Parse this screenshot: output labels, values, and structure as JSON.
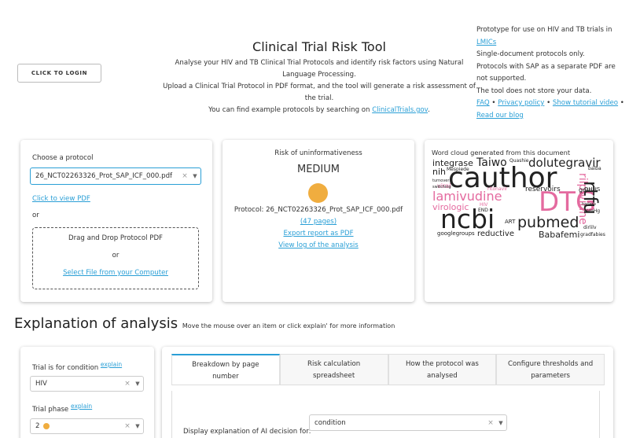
{
  "login": {
    "label": "CLICK TO LOGIN"
  },
  "header": {
    "title": "Clinical Trial Risk Tool",
    "line1": "Analyse your HIV and TB Clinical Trial Protocols and identify risk factors using Natural",
    "line2": "Language Processing.",
    "line3": "Upload a Clinical Trial Protocol in PDF format, and the tool will generate a risk assessment of",
    "line4": "the trial.",
    "line5_prefix": "You can find example protocols by searching on ",
    "line5_link": "ClinicalTrials.gov",
    "line5_suffix": "."
  },
  "info": {
    "line1": "Prototype for use on HIV and TB trials in",
    "lmics": "LMICs",
    "line2": "Single-document protocols only.",
    "line3": "Protocols with SAP as a separate PDF are",
    "line4": "not supported.",
    "line5": "The tool does not store your data.",
    "faq": "FAQ",
    "bullet": "•",
    "privacy": "Privacy policy",
    "tutorial": "Show tutorial video",
    "blog": "Read our blog"
  },
  "protocol_card": {
    "label": "Choose a protocol",
    "selected": "26_NCT02263326_Prot_SAP_ICF_000.pdf",
    "view_pdf": "Click to view PDF",
    "or": "or",
    "drop_text": "Drag and Drop Protocol PDF",
    "drop_or": "or",
    "select_file": "Select File from your Computer"
  },
  "risk_card": {
    "title": "Risk of uninformativeness",
    "level": "MEDIUM",
    "level_color": "#f0ad3f",
    "protocol": "Protocol: 26_NCT02263326_Prot_SAP_ICF_000.pdf",
    "pages": "(47 pages)",
    "export": "Export report as PDF",
    "log": "View log of the analysis"
  },
  "wordcloud": {
    "title": "Word cloud generated from this document",
    "words": [
      {
        "text": "integrase",
        "color": "#222222"
      },
      {
        "text": "Taiwo",
        "color": "#222222"
      },
      {
        "text": "Quashie",
        "color": "#222222"
      },
      {
        "text": "dolutegravir",
        "color": "#222222"
      },
      {
        "text": "nih",
        "color": "#222222"
      },
      {
        "text": "Mespiede",
        "color": "#222222"
      },
      {
        "text": "cauthor",
        "color": "#222222"
      },
      {
        "text": "lamivudine",
        "color": "#e46a9f"
      },
      {
        "text": "virologic",
        "color": "#e46a9f"
      },
      {
        "text": "DTG",
        "color": "#e46a9f"
      },
      {
        "text": "ncbi",
        "color": "#222222"
      },
      {
        "text": "pubmed",
        "color": "#222222"
      },
      {
        "text": "googlegroups",
        "color": "#222222"
      },
      {
        "text": "reductive",
        "color": "#222222"
      },
      {
        "text": "Babafemi",
        "color": "#222222"
      },
      {
        "text": "reservoirs",
        "color": "#222222"
      },
      {
        "text": "rilpivirine",
        "color": "#e46a9f"
      },
      {
        "text": "ritonavir",
        "color": "#e46a9f"
      },
      {
        "text": "viral",
        "color": "#e46a9f"
      },
      {
        "text": "DHHS",
        "color": "#222222"
      },
      {
        "text": "ART",
        "color": "#222222"
      },
      {
        "text": "END",
        "color": "#222222"
      },
      {
        "text": "HIV",
        "color": "#e46a9f"
      },
      {
        "text": "gov",
        "color": "#222222"
      },
      {
        "text": "baiba",
        "color": "#222222"
      },
      {
        "text": "harless",
        "color": "#222222"
      },
      {
        "text": "mmHg",
        "color": "#222222"
      },
      {
        "text": "switching",
        "color": "#222222"
      },
      {
        "text": "turnover",
        "color": "#222222"
      },
      {
        "text": "gradfabies",
        "color": "#222222"
      },
      {
        "text": "dirlilv",
        "color": "#222222"
      },
      {
        "text": "rtfu",
        "color": "#222222"
      }
    ]
  },
  "explanation": {
    "title": "Explanation of analysis",
    "subtitle": "Move the mouse over an item or click explain' for more information"
  },
  "side_panel": {
    "condition_label": "Trial is for condition",
    "explain1": "explain",
    "condition_value": "HIV",
    "phase_label": "Trial phase",
    "explain2": "explain",
    "phase_value": "2"
  },
  "tabs": [
    {
      "line1": "Breakdown by page",
      "line2": "number"
    },
    {
      "line1": "Risk calculation",
      "line2": "spreadsheet"
    },
    {
      "line1": "How the protocol was",
      "line2": "analysed"
    },
    {
      "line1": "Configure thresholds and",
      "line2": "parameters"
    }
  ],
  "ai_decision": {
    "label": "Display explanation of AI decision for:",
    "value": "condition"
  }
}
